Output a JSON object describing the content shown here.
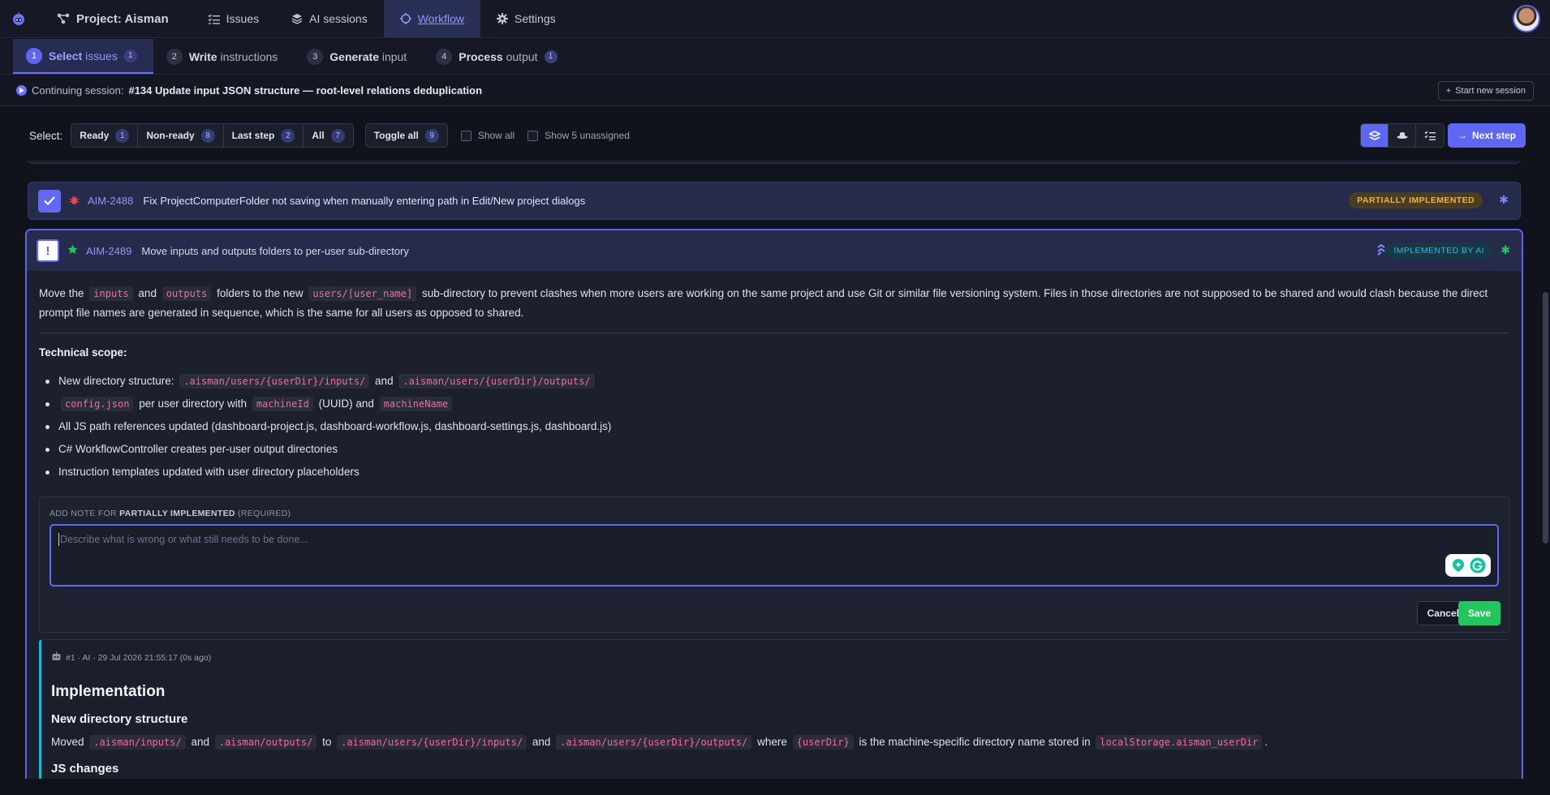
{
  "nav": {
    "project": "Project: Aisman",
    "issues": "Issues",
    "ai_sessions": "AI sessions",
    "workflow": "Workflow",
    "settings": "Settings"
  },
  "steps": [
    {
      "num": "1",
      "bold": "Select",
      "rest": " issues",
      "count": "1"
    },
    {
      "num": "2",
      "bold": "Write",
      "rest": " instructions",
      "count": ""
    },
    {
      "num": "3",
      "bold": "Generate",
      "rest": " input",
      "count": ""
    },
    {
      "num": "4",
      "bold": "Process",
      "rest": " output",
      "count": "1"
    }
  ],
  "session": {
    "prefix": "Continuing session:",
    "title": "#134 Update input JSON structure — root-level relations deduplication",
    "new_button": "Start new session"
  },
  "toolbar": {
    "select_label": "Select:",
    "ready": "Ready",
    "ready_count": "1",
    "nonready": "Non-ready",
    "nonready_count": "8",
    "laststep": "Last step",
    "laststep_count": "2",
    "all": "All",
    "all_count": "7",
    "toggle": "Toggle all",
    "toggle_count": "9",
    "show_all": "Show all",
    "show_unassigned": "Show 5 unassigned",
    "next": "Next step"
  },
  "issues": [
    {
      "key": "AIM-2488",
      "title": "Fix ProjectComputerFolder not saving when manually entering path in Edit/New project dialogs",
      "status": "PARTIALLY IMPLEMENTED"
    },
    {
      "key": "AIM-2489",
      "title": "Move inputs and outputs folders to per-user sub-directory",
      "status": "IMPLEMENTED BY AI"
    }
  ],
  "detail": {
    "d1": "Move the",
    "c_inputs": "inputs",
    "d2": "and",
    "c_outputs": "outputs",
    "d3": "folders to the new",
    "c_users": "users/[user_name]",
    "d4": "sub-directory to prevent clashes when more users are working on the same project and use Git or similar file versioning system. Files in those directories are not supposed to be shared and would clash because the direct prompt file names are generated in sequence, which is the same for all users as opposed to shared.",
    "scope_title": "Technical scope:",
    "s1a": "New directory structure:",
    "s1c1": ".aisman/users/{userDir}/inputs/",
    "s1b": "and",
    "s1c2": ".aisman/users/{userDir}/outputs/",
    "s2c1": "config.json",
    "s2a": "per user directory with",
    "s2c2": "machineId",
    "s2b": "(UUID) and",
    "s2c3": "machineName",
    "s3": "All JS path references updated (dashboard-project.js, dashboard-workflow.js, dashboard-settings.js, dashboard.js)",
    "s4": "C# WorkflowController creates per-user output directories",
    "s5": "Instruction templates updated with user directory placeholders"
  },
  "note": {
    "label_pre": "ADD NOTE FOR",
    "label_bold": "PARTIALLY IMPLEMENTED",
    "label_post": "(REQUIRED)",
    "placeholder": "Describe what is wrong or what still needs to be done...",
    "cancel": "Cancel",
    "save": "Save"
  },
  "comment": {
    "meta": "#1 · AI · 29 Jul 2026 21:55:17 (0s ago)",
    "h1": "Implementation",
    "h2": "New directory structure",
    "p1": "Moved",
    "c1": ".aisman/inputs/",
    "p2": "and",
    "c2": ".aisman/outputs/",
    "p3": "to",
    "c3": ".aisman/users/{userDir}/inputs/",
    "p4": "and",
    "c4": ".aisman/users/{userDir}/outputs/",
    "p5": "where",
    "c5": "{userDir}",
    "p6": "is the machine-specific directory name stored in",
    "c6": "localStorage.aisman_userDir",
    "p7": ".",
    "h3": "JS changes"
  },
  "colors": {
    "accent": "#5f67f2",
    "partial": "#f3b13b",
    "ai": "#2fb8e0",
    "save": "#22c55e"
  }
}
